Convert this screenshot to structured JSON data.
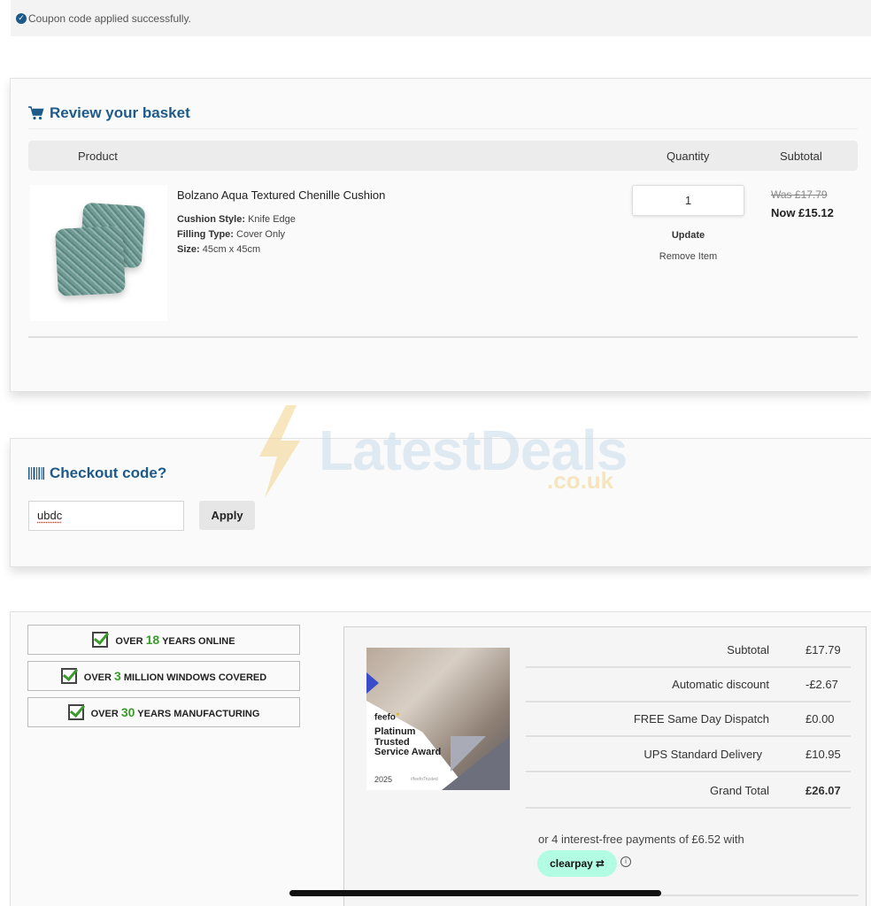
{
  "notice": {
    "text": "Coupon code applied successfully."
  },
  "basket": {
    "title": "Review your basket",
    "columns": {
      "product": "Product",
      "quantity": "Quantity",
      "subtotal": "Subtotal"
    },
    "item": {
      "name": "Bolzano Aqua Textured Chenille Cushion",
      "attributes": [
        {
          "label": "Cushion Style:",
          "value": "Knife Edge"
        },
        {
          "label": "Filling Type:",
          "value": "Cover Only"
        },
        {
          "label": "Size:",
          "value": "45cm x 45cm"
        }
      ],
      "quantity": "1",
      "update_label": "Update",
      "remove_label": "Remove Item",
      "was_price": "Was £17.79",
      "now_price": "Now £15.12"
    }
  },
  "checkout_code": {
    "title": "Checkout code?",
    "value": "ubdc",
    "apply_label": "Apply"
  },
  "watermark": {
    "text": "LatestDeals",
    "sub": ".co.uk"
  },
  "trust_badges": [
    {
      "prefix": "OVER",
      "number": "18",
      "suffix": "YEARS ONLINE"
    },
    {
      "prefix": "OVER",
      "number": "3",
      "suffix": "MILLION WINDOWS COVERED"
    },
    {
      "prefix": "OVER",
      "number": "30",
      "suffix": "YEARS MANUFACTURING"
    }
  ],
  "award": {
    "brand": "feefo",
    "title": "Platinum Trusted Service Award",
    "year": "2025",
    "tag": "#feefoTrusted"
  },
  "totals": [
    {
      "label": "Subtotal",
      "value": "£17.79"
    },
    {
      "label": "Automatic discount",
      "value": "-£2.67"
    },
    {
      "label": "FREE Same Day Dispatch",
      "value": "£0.00"
    },
    {
      "label": "UPS Standard Delivery",
      "value": "£10.95"
    },
    {
      "label": "Grand Total",
      "value": "£26.07"
    }
  ],
  "clearpay": {
    "text": "or 4 interest-free payments of £6.52 with",
    "brand": "clearpay",
    "info": "i"
  },
  "colors": {
    "accent": "#1d5a8a",
    "highlight_green": "#3a9a2c",
    "clearpay_mint": "#b2fce4"
  }
}
